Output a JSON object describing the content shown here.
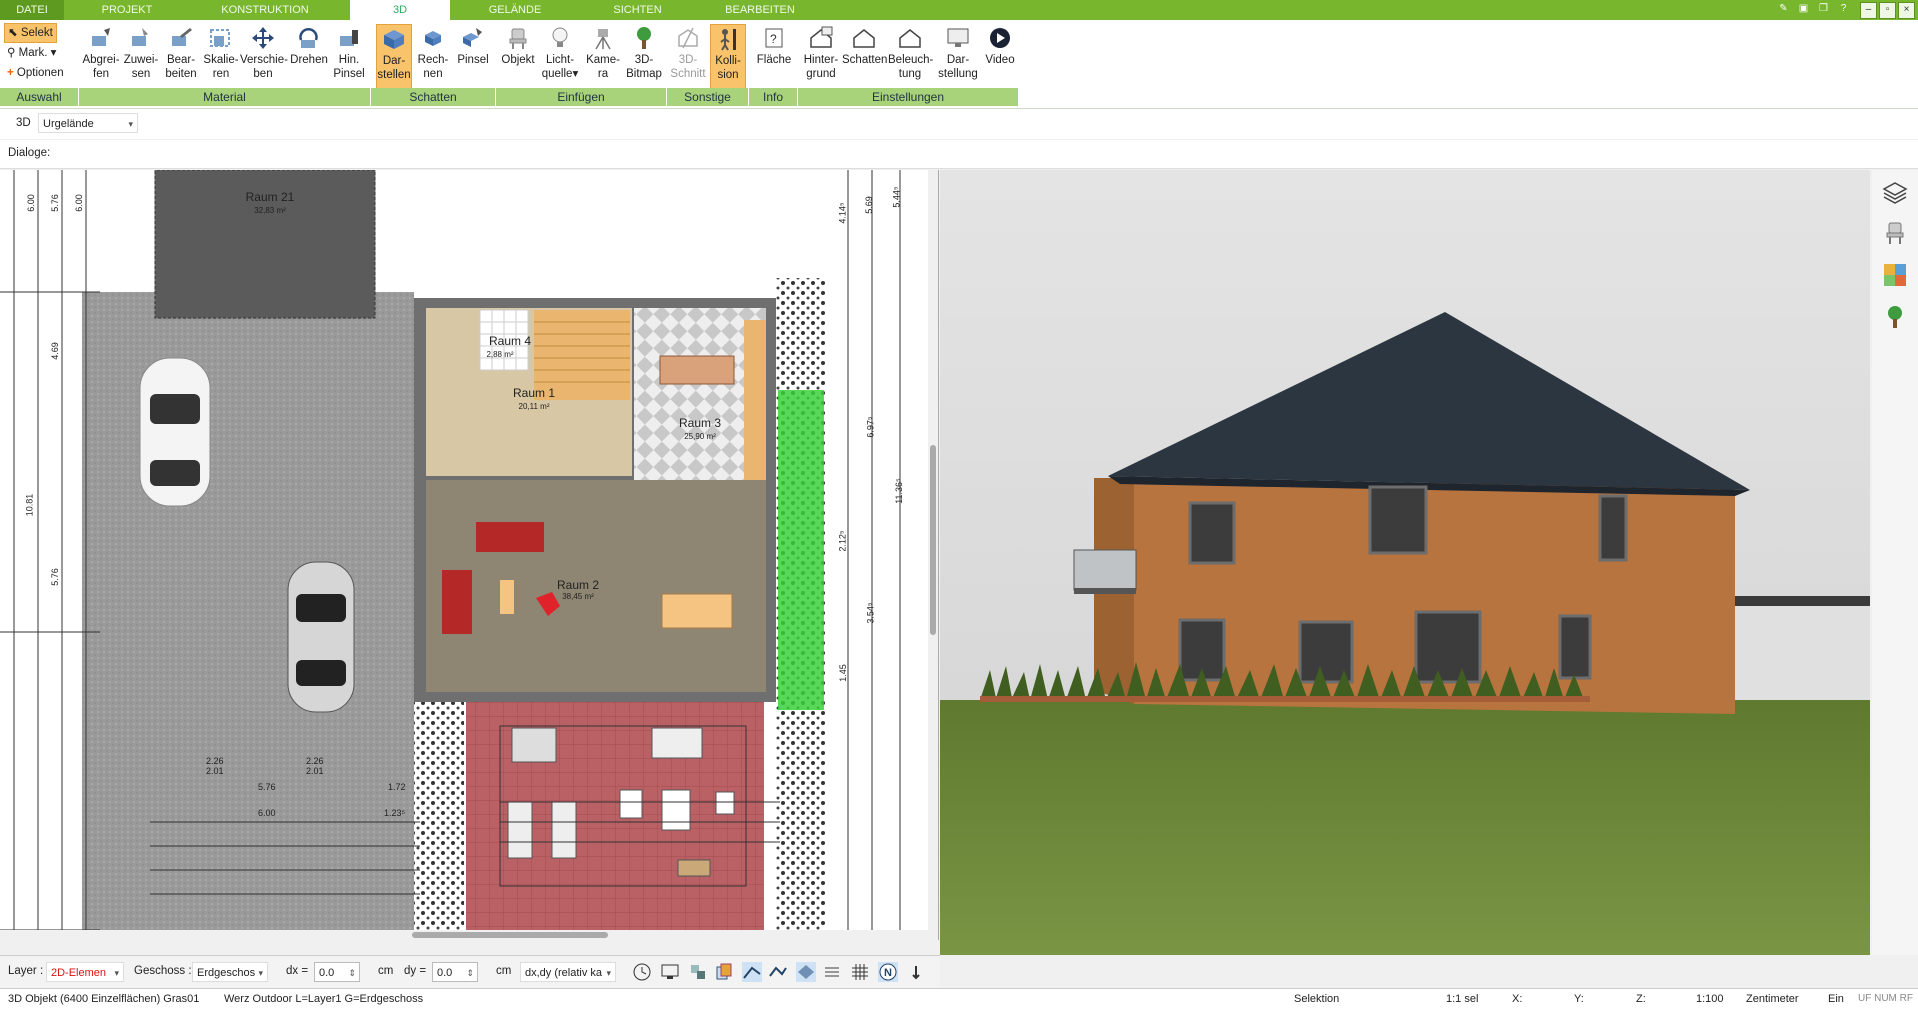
{
  "tabs": [
    {
      "label": "DATEI",
      "active": false
    },
    {
      "label": "PROJEKT",
      "active": false
    },
    {
      "label": "KONSTRUKTION",
      "active": false
    },
    {
      "label": "3D",
      "active": true
    },
    {
      "label": "GELÄNDE",
      "active": false
    },
    {
      "label": "SICHTEN",
      "active": false
    },
    {
      "label": "BEARBEITEN",
      "active": false
    }
  ],
  "auswahl": {
    "selekt": "Selekt",
    "mark": "Mark.",
    "optionen": "Optionen"
  },
  "ribbon_buttons": [
    {
      "line1": "Abgrei-",
      "line2": "fen",
      "icon": "eyedropper-icon"
    },
    {
      "line1": "Zuwei-",
      "line2": "sen",
      "icon": "assign-material-icon"
    },
    {
      "line1": "Bear-",
      "line2": "beiten",
      "icon": "edit-material-icon"
    },
    {
      "line1": "Skalie-",
      "line2": "ren",
      "icon": "scale-icon"
    },
    {
      "line1": "Verschie-",
      "line2": "ben",
      "icon": "move-icon"
    },
    {
      "line1": "Drehen",
      "line2": "",
      "icon": "rotate-icon"
    },
    {
      "line1": "Hin.",
      "line2": "Pinsel",
      "icon": "brush-icon"
    },
    {
      "line1": "Dar-",
      "line2": "stellen",
      "icon": "cube-shading-icon"
    },
    {
      "line1": "Rech-",
      "line2": "nen",
      "icon": "calc-shadow-icon"
    },
    {
      "line1": "Pinsel",
      "line2": "",
      "icon": "shadow-brush-icon"
    },
    {
      "line1": "Objekt",
      "line2": "",
      "icon": "chair-icon"
    },
    {
      "line1": "Licht-",
      "line2": "quelle",
      "icon": "lightbulb-icon"
    },
    {
      "line1": "Kame-",
      "line2": "ra",
      "icon": "camera-icon"
    },
    {
      "line1": "3D-",
      "line2": "Bitmap",
      "icon": "tree-icon"
    },
    {
      "line1": "3D-",
      "line2": "Schnitt",
      "icon": "section-icon"
    },
    {
      "line1": "Kolli-",
      "line2": "sion",
      "icon": "collision-icon"
    },
    {
      "line1": "Fläche",
      "line2": "",
      "icon": "area-info-icon"
    },
    {
      "line1": "Hinter-",
      "line2": "grund",
      "icon": "background-icon"
    },
    {
      "line1": "Schatten",
      "line2": "",
      "icon": "house-shadow-icon"
    },
    {
      "line1": "Beleuch-",
      "line2": "tung",
      "icon": "house-light-icon"
    },
    {
      "line1": "Dar-",
      "line2": "stellung",
      "icon": "monitor-icon"
    },
    {
      "line1": "Video",
      "line2": "",
      "icon": "play-icon"
    }
  ],
  "groups": [
    "Auswahl",
    "Material",
    "Schatten",
    "Einfügen",
    "Sonstige",
    "Info",
    "Einstellungen"
  ],
  "bar2": {
    "mode": "3D",
    "layer_select": "Urgelände"
  },
  "bar3": {
    "label": "Dialoge:"
  },
  "plan": {
    "rooms": [
      {
        "name": "Raum 21",
        "area": "32,83 m²"
      },
      {
        "name": "Raum 4",
        "area": "2,88 m²"
      },
      {
        "name": "Raum 1",
        "area": "20,11 m²"
      },
      {
        "name": "Raum 3",
        "area": "25,90 m²"
      },
      {
        "name": "Raum 2",
        "area": "38,45 m²"
      }
    ],
    "dims_left": [
      "6.00",
      "5.76",
      "6.00",
      "4.69",
      "10.81",
      "5.76"
    ],
    "dims_bottom": [
      "2.26",
      "2.01",
      "2.26",
      "2.01",
      "5.76",
      "6.00",
      "1.72",
      "1.23⁵"
    ],
    "dims_right": [
      "4.14⁵",
      "5.69",
      "5.44⁵",
      "6.97⁵",
      "11.36⁵",
      "2.12⁵",
      "3.54⁵",
      "1.45"
    ]
  },
  "bottom": {
    "layer_label": "Layer :",
    "layer_value": "2D-Elemen",
    "geschoss_label": "Geschoss :",
    "geschoss_value": "Erdgeschos",
    "dx_label": "dx =",
    "dx_value": "0.0",
    "dx_unit": "cm",
    "dy_label": "dy =",
    "dy_value": "0.0",
    "dy_unit": "cm",
    "mode_value": "dx,dy (relativ ka"
  },
  "status": {
    "left": "3D Objekt (6400 Einzelflächen) Gras01",
    "layer": "Werz Outdoor L=Layer1 G=Erdgeschoss",
    "selektion": "Selektion",
    "sel_count": "1:1 sel",
    "x": "X:",
    "y": "Y:",
    "z": "Z:",
    "scale": "1:100",
    "unit": "Zentimeter",
    "ein": "Ein",
    "flags": "UF NUM RF"
  },
  "colors": {
    "accent": "#78b62e",
    "group_bg": "#a9d37b",
    "active_btn": "#f9c36b",
    "sky": "#dcdcdc",
    "grass": "#6d8a3b",
    "wall": "#b8743f",
    "roof": "#2c3640"
  }
}
